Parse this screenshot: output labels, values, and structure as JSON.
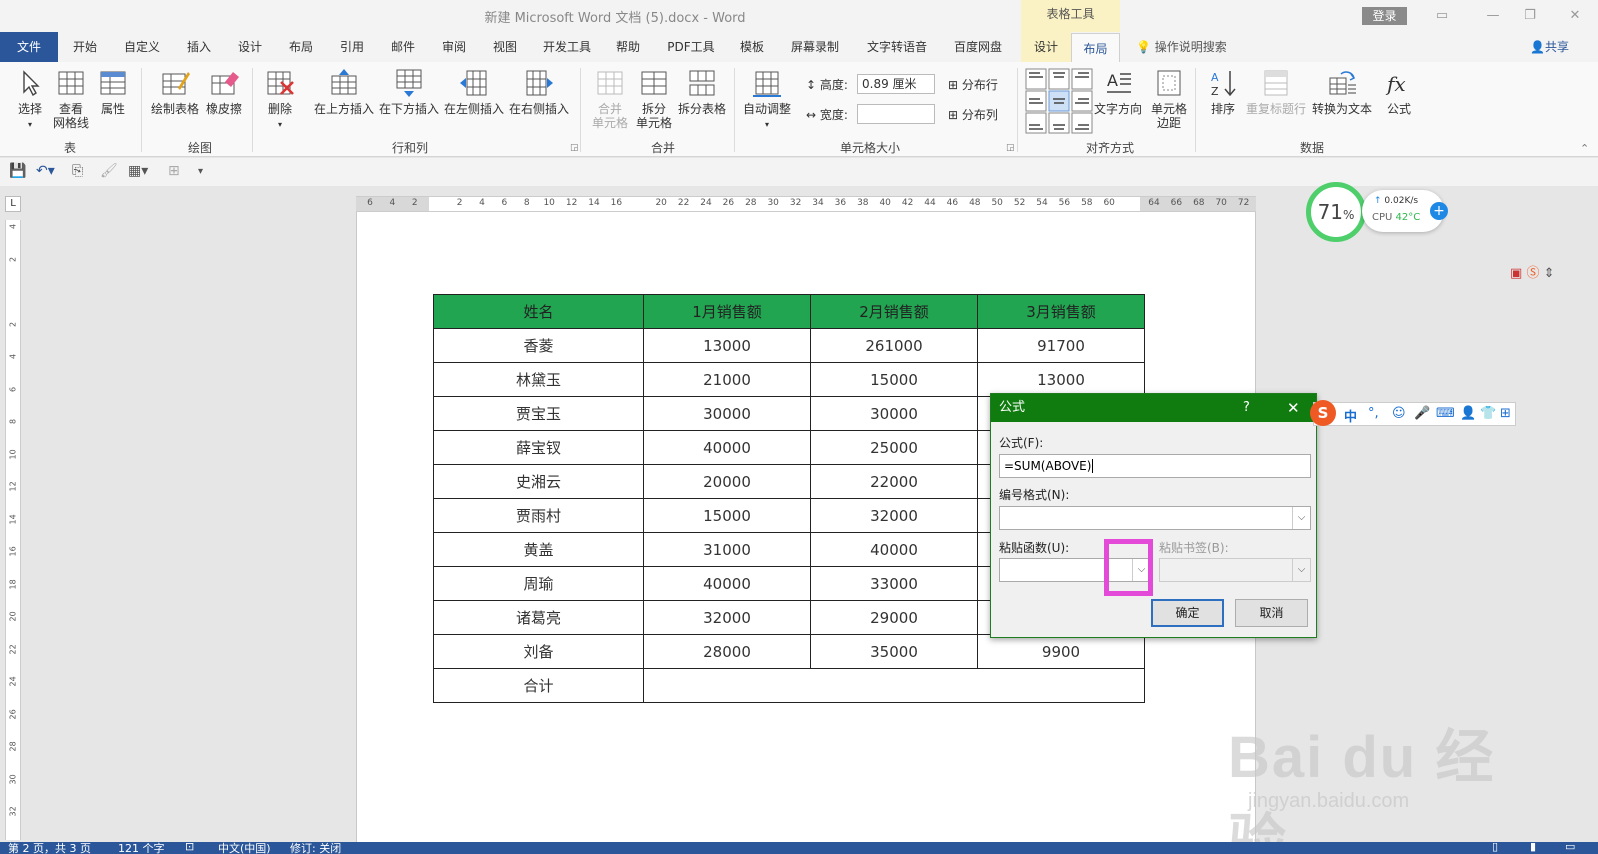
{
  "window": {
    "title": "新建 Microsoft Word 文档 (5).docx  -  Word",
    "context_group": "表格工具",
    "login": "登录"
  },
  "tabs": {
    "file": "文件",
    "items": [
      "开始",
      "自定义",
      "插入",
      "设计",
      "布局",
      "引用",
      "邮件",
      "审阅",
      "视图",
      "开发工具",
      "帮助",
      "PDF工具",
      "模板",
      "屏幕录制",
      "文字转语音",
      "百度网盘"
    ],
    "context_tabs": [
      "设计",
      "布局"
    ],
    "active_context_tab": "布局",
    "tell_me": "操作说明搜索",
    "share": "共享"
  },
  "ribbon": {
    "group_table": {
      "label": "表",
      "select": "选择",
      "view_gridlines_1": "查看",
      "view_gridlines_2": "网格线",
      "properties": "属性"
    },
    "group_draw": {
      "label": "绘图",
      "draw_table": "绘制表格",
      "eraser": "橡皮擦"
    },
    "group_rows_cols": {
      "label": "行和列",
      "delete": "删除",
      "insert_above": "在上方插入",
      "insert_below": "在下方插入",
      "insert_left": "在左侧插入",
      "insert_right": "在右侧插入"
    },
    "group_merge": {
      "label": "合并",
      "merge_cells_1": "合并",
      "merge_cells_2": "单元格",
      "split_cells_1": "拆分",
      "split_cells_2": "单元格",
      "split_table": "拆分表格"
    },
    "group_cell_size": {
      "label": "单元格大小",
      "autofit": "自动调整",
      "height_label": "高度:",
      "height_value": "0.89 厘米",
      "width_label": "宽度:",
      "width_value": "",
      "distribute_rows": "分布行",
      "distribute_cols": "分布列"
    },
    "group_alignment": {
      "label": "对齐方式",
      "text_direction": "文字方向",
      "cell_margins_1": "单元格",
      "cell_margins_2": "边距"
    },
    "group_data": {
      "label": "数据",
      "sort": "排序",
      "repeat_header": "重复标题行",
      "convert_to_text": "转换为文本",
      "formula": "公式"
    }
  },
  "ruler": {
    "ticks": [
      "6",
      "4",
      "2",
      "",
      "2",
      "4",
      "6",
      "8",
      "10",
      "12",
      "14",
      "16",
      "",
      "20",
      "22",
      "24",
      "26",
      "28",
      "30",
      "32",
      "34",
      "36",
      "38",
      "40",
      "42",
      "44",
      "46",
      "48",
      "50",
      "52",
      "54",
      "56",
      "58",
      "60",
      "",
      "64",
      "66",
      "68",
      "70",
      "72"
    ],
    "vticks": [
      "4",
      "2",
      "",
      "2",
      "4",
      "6",
      "8",
      "10",
      "12",
      "14",
      "16",
      "18",
      "20",
      "22",
      "24",
      "26",
      "28",
      "30",
      "32"
    ]
  },
  "table": {
    "headers": [
      "姓名",
      "1月销售额",
      "2月销售额",
      "3月销售额"
    ],
    "rows": [
      [
        "香菱",
        "13000",
        "261000",
        "91700"
      ],
      [
        "林黛玉",
        "21000",
        "15000",
        "13000"
      ],
      [
        "贾宝玉",
        "30000",
        "30000",
        ""
      ],
      [
        "薛宝钗",
        "40000",
        "25000",
        ""
      ],
      [
        "史湘云",
        "20000",
        "22000",
        ""
      ],
      [
        "贾雨村",
        "15000",
        "32000",
        ""
      ],
      [
        "黄盖",
        "31000",
        "40000",
        ""
      ],
      [
        "周瑜",
        "40000",
        "33000",
        ""
      ],
      [
        "诸葛亮",
        "32000",
        "29000",
        ""
      ],
      [
        "刘备",
        "28000",
        "35000",
        "9900"
      ]
    ],
    "total_label": "合计"
  },
  "dialog": {
    "title": "公式",
    "help": "?",
    "close": "✕",
    "formula_label": "公式(F):",
    "formula_value": "=SUM(ABOVE)",
    "number_format_label": "编号格式(N):",
    "number_format_value": "",
    "paste_function_label": "粘贴函数(U):",
    "paste_function_value": "",
    "paste_bookmark_label": "粘贴书签(B):",
    "paste_bookmark_value": "",
    "ok": "确定",
    "cancel": "取消"
  },
  "ime": {
    "logo": "S",
    "mode": "中"
  },
  "widget": {
    "cpu_usage": "71",
    "cpu_unit": "%",
    "net_speed": "0.02K/s",
    "cpu_label": "CPU",
    "cpu_temp": "42°C"
  },
  "watermark": {
    "main": "Bai du 经验",
    "sub": "jingyan.baidu.com"
  },
  "status": {
    "page": "第 2 页，共 3 页",
    "words": "121 个字",
    "language": "中文(中国)",
    "track_changes": "修订: 关闭"
  },
  "colors": {
    "word_blue": "#2b579a",
    "header_green": "#21a551",
    "dialog_green": "#107c10",
    "highlight": "#e34ad8",
    "context_yellow": "#faf2c4"
  }
}
